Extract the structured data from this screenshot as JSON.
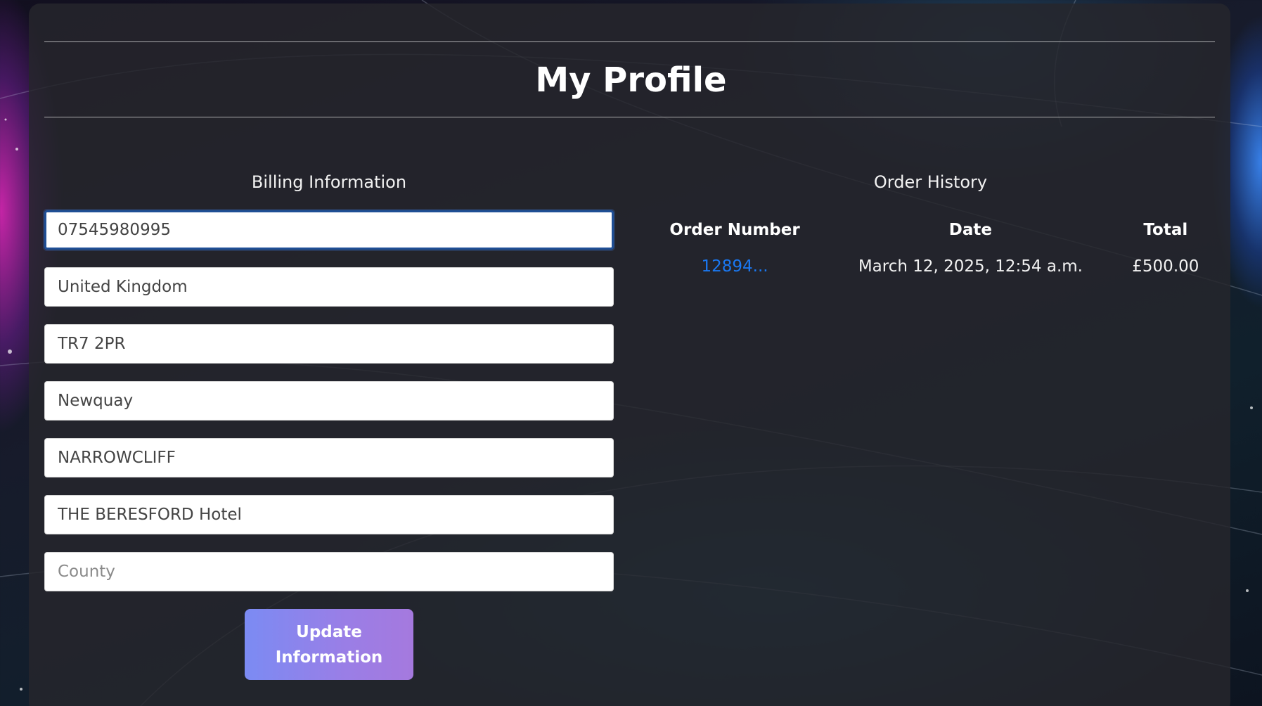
{
  "page": {
    "title": "My Profile"
  },
  "billing": {
    "heading": "Billing Information",
    "fields": [
      {
        "name": "phone",
        "value": "07545980995",
        "placeholder": ""
      },
      {
        "name": "country",
        "value": "United Kingdom",
        "placeholder": ""
      },
      {
        "name": "postcode",
        "value": "TR7 2PR",
        "placeholder": ""
      },
      {
        "name": "town",
        "value": "Newquay",
        "placeholder": ""
      },
      {
        "name": "street",
        "value": "NARROWCLIFF",
        "placeholder": ""
      },
      {
        "name": "address",
        "value": "THE BERESFORD Hotel",
        "placeholder": ""
      },
      {
        "name": "county",
        "value": "",
        "placeholder": "County"
      }
    ],
    "update_button_label": "Update Information"
  },
  "orders": {
    "heading": "Order History",
    "columns": [
      "Order Number",
      "Date",
      "Total"
    ],
    "rows": [
      {
        "order_number": "12894...",
        "date": "March 12, 2025, 12:54 a.m.",
        "total": "£500.00"
      }
    ]
  },
  "colors": {
    "link": "#1a78f2",
    "button_gradient_start": "#7b8bf3",
    "button_gradient_end": "#a579de",
    "focus_border": "#1f4f96"
  }
}
